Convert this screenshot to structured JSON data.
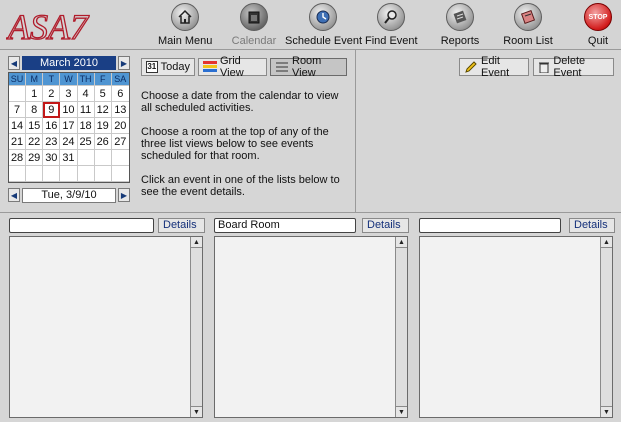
{
  "toolbar": {
    "logo_text": "ASA7",
    "buttons": [
      {
        "label": "Main Menu",
        "icon": "home-icon"
      },
      {
        "label": "Calendar",
        "icon": "calendar-icon"
      },
      {
        "label": "Schedule Event",
        "icon": "schedule-icon"
      },
      {
        "label": "Find Event",
        "icon": "magnifier-icon"
      },
      {
        "label": "Reports",
        "icon": "reports-icon"
      },
      {
        "label": "Room List",
        "icon": "room-list-icon"
      },
      {
        "label": "Quit",
        "icon": "stop-icon",
        "icon_text": "STOP"
      }
    ]
  },
  "calendar": {
    "month_label": "March 2010",
    "days_of_week": [
      "SU",
      "M",
      "T",
      "W",
      "TH",
      "F",
      "SA"
    ],
    "weeks": [
      [
        "",
        "1",
        "2",
        "3",
        "4",
        "5",
        "6"
      ],
      [
        "7",
        "8",
        "9",
        "10",
        "11",
        "12",
        "13"
      ],
      [
        "14",
        "15",
        "16",
        "17",
        "18",
        "19",
        "20"
      ],
      [
        "21",
        "22",
        "23",
        "24",
        "25",
        "26",
        "27"
      ],
      [
        "28",
        "29",
        "30",
        "31",
        "",
        "",
        ""
      ],
      [
        "",
        "",
        "",
        "",
        "",
        "",
        ""
      ]
    ],
    "selected_day": "9",
    "selected_date_label": "Tue, 3/9/10",
    "header_color": "#1a3f85",
    "dow_color": "#4f95d2",
    "selection_color": "#c21818"
  },
  "views": {
    "today_label": "Today",
    "today_icon_text": "31",
    "grid_label": "Grid View",
    "room_label": "Room View",
    "active": "Room View"
  },
  "instructions": [
    "Choose a date from the calendar to view all scheduled activities.",
    "Choose a room at the top of any of the three list views below to see events scheduled for that room.",
    "Click an event in one of the lists below to see the event details."
  ],
  "actions": {
    "edit_label": "Edit Event",
    "delete_label": "Delete Event"
  },
  "lists": [
    {
      "room": "",
      "details_label": "Details"
    },
    {
      "room": "Board Room",
      "details_label": "Details"
    },
    {
      "room": "",
      "details_label": "Details"
    }
  ]
}
